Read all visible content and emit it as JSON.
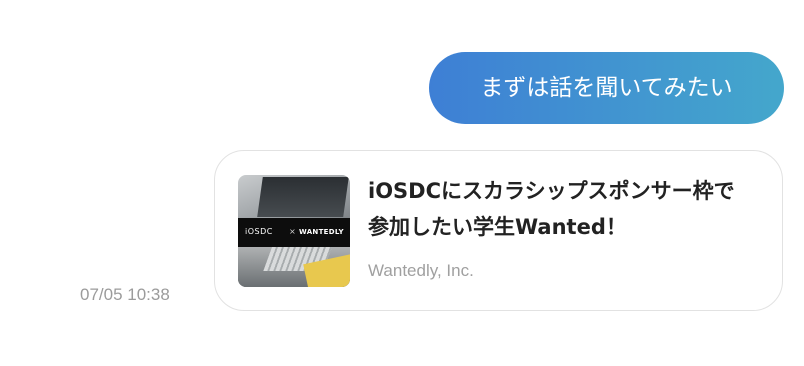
{
  "message": {
    "text": "まずは話を聞いてみたい",
    "gradient_start": "#3e7fd5",
    "gradient_end": "#44a7cc"
  },
  "timestamp": "07/05 10:38",
  "link_card": {
    "title": "iOSDCにスカラシップスポンサー枠で参加したい学生Wanted！",
    "source": "Wantedly, Inc.",
    "thumbnail": {
      "logo_text": "iOSDC",
      "separator": "×",
      "brand_text": "WANTEDLY"
    }
  }
}
